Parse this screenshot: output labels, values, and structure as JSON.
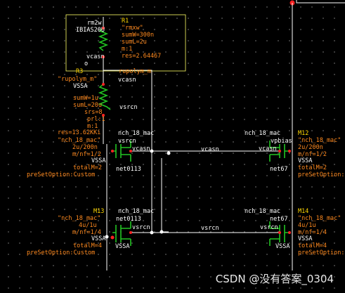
{
  "r_block": {
    "model": "rm2w",
    "inst": "IBIAS20U",
    "name": "R1",
    "cell": "\"rmxw\"",
    "p1": "sumW=300n",
    "p2": "sumL=2u",
    "p3": "m:1",
    "p4": "res=2.64467",
    "pin": "vcasn",
    "pin_o": "o"
  },
  "r3_block": {
    "name": "R3",
    "model": "rupolym_m",
    "cell": "\"rupolym_m\"",
    "vdd": "VSSA",
    "top_pin": "vcasn",
    "bottom_pin": "vsrcn",
    "p1": "sumW=1u",
    "p2": "sumL=20u",
    "p3": "srs=8",
    "p4": "prl:1",
    "p5": "m:1",
    "p6": "res=13.62KKi"
  },
  "m_top_left": {
    "model": "nch_18_mac",
    "cell": "\"nch_18_mac\"",
    "p1": "2u/200n",
    "p2": "m/nf=1/2",
    "pin_l": "VSSA",
    "pin_r": "vcasn",
    "drain": "vsrcn",
    "net": "net0113",
    "p3": "totalM=2",
    "p4": "preSetOption:Custom"
  },
  "m_top_right": {
    "name": "M12",
    "model": "nch_18_mac",
    "cell": "\"nch_18_mac\"",
    "p1": "2u/200n",
    "p2": "m/nf=1/2",
    "pin_l": "vcasn",
    "pin_r": "VSSA",
    "drain": "vpbias",
    "net": "net67",
    "p3": "totalM=2",
    "p4": "preSetOption:Custom"
  },
  "m_bot_left": {
    "name": "M13",
    "model": "nch_18_mac",
    "cell": "\"nch_18_mac\"",
    "p1": "4u/1u",
    "p2": "m/nf=1/4",
    "pin_l": "VSSA",
    "pin_r": "vsrcn",
    "drain": "net0113",
    "bulk": "VSSA",
    "p3": "totalM=4",
    "p4": "preSetOption:Custom"
  },
  "m_bot_right": {
    "name": "M14",
    "model": "nch_18_mac",
    "cell": "\"nch_18_mac\"",
    "p1": "4u/1u",
    "p2": "m/nf=1/4",
    "pin_l": "vsrcn",
    "pin_r": "VSSA",
    "drain": "net67",
    "bulk": "VSSA",
    "p3": "totalM=4",
    "p4": "preSetOption:Custom"
  },
  "nets": {
    "vcasn": "vcasn",
    "vsrcn": "vsrcn"
  },
  "watermark": "CSDN @没有答案_0304",
  "colors": {
    "background": "#000000",
    "wire": "#ffffff",
    "device": "#22c422",
    "param": "#ff8a1f",
    "label": "#ffffff",
    "highlight": "#ffff66",
    "pin": "#ff2222"
  }
}
